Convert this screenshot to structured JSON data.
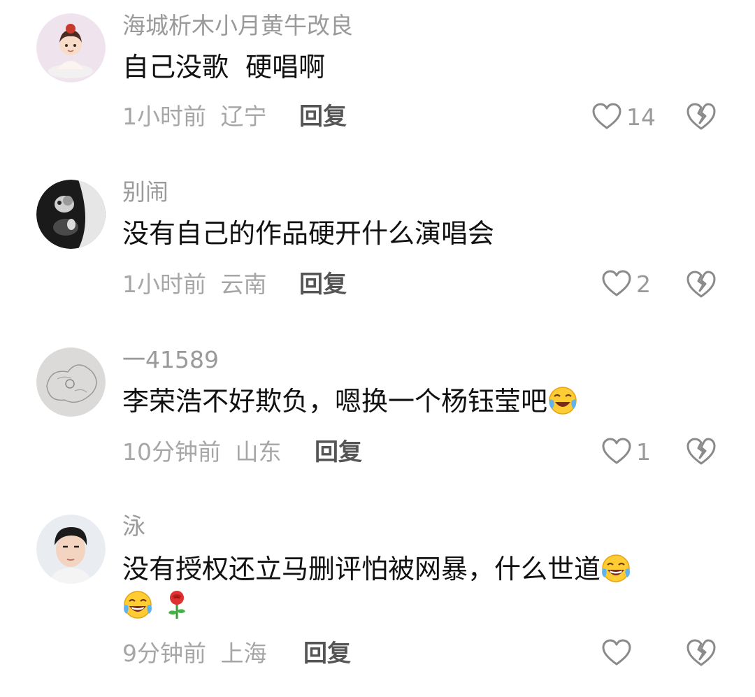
{
  "comments": [
    {
      "username": "海城析木小月黄牛改良",
      "text": "自己没歌  硬唱啊",
      "time": "1小时前",
      "location": "辽宁",
      "reply_label": "回复",
      "likes": "14",
      "avatar_icon": "girl-meditating-avatar"
    },
    {
      "username": "别闹",
      "text": "没有自己的作品硬开什么演唱会",
      "time": "1小时前",
      "location": "云南",
      "reply_label": "回复",
      "likes": "2",
      "avatar_icon": "dark-photo-avatar"
    },
    {
      "username": "一41589",
      "text": "李荣浩不好欺负，嗯换一个杨钰莹吧",
      "emoji_icons": [
        "crying-laughing-emoji"
      ],
      "time": "10分钟前",
      "location": "山东",
      "reply_label": "回复",
      "likes": "1",
      "avatar_icon": "sketch-avatar"
    },
    {
      "username": "泳",
      "text": "没有授权还立马删评怕被网暴，什么世道",
      "emoji_icons": [
        "joy-emoji",
        "joy-emoji",
        "rose-emoji"
      ],
      "time": "9分钟前",
      "location": "上海",
      "reply_label": "回复",
      "likes": "",
      "avatar_icon": "young-man-avatar"
    }
  ],
  "colors": {
    "username": "#9a9a9a",
    "text": "#111111",
    "meta": "#a6a6a6",
    "reply": "#555555",
    "icon": "#8a8a8a"
  }
}
